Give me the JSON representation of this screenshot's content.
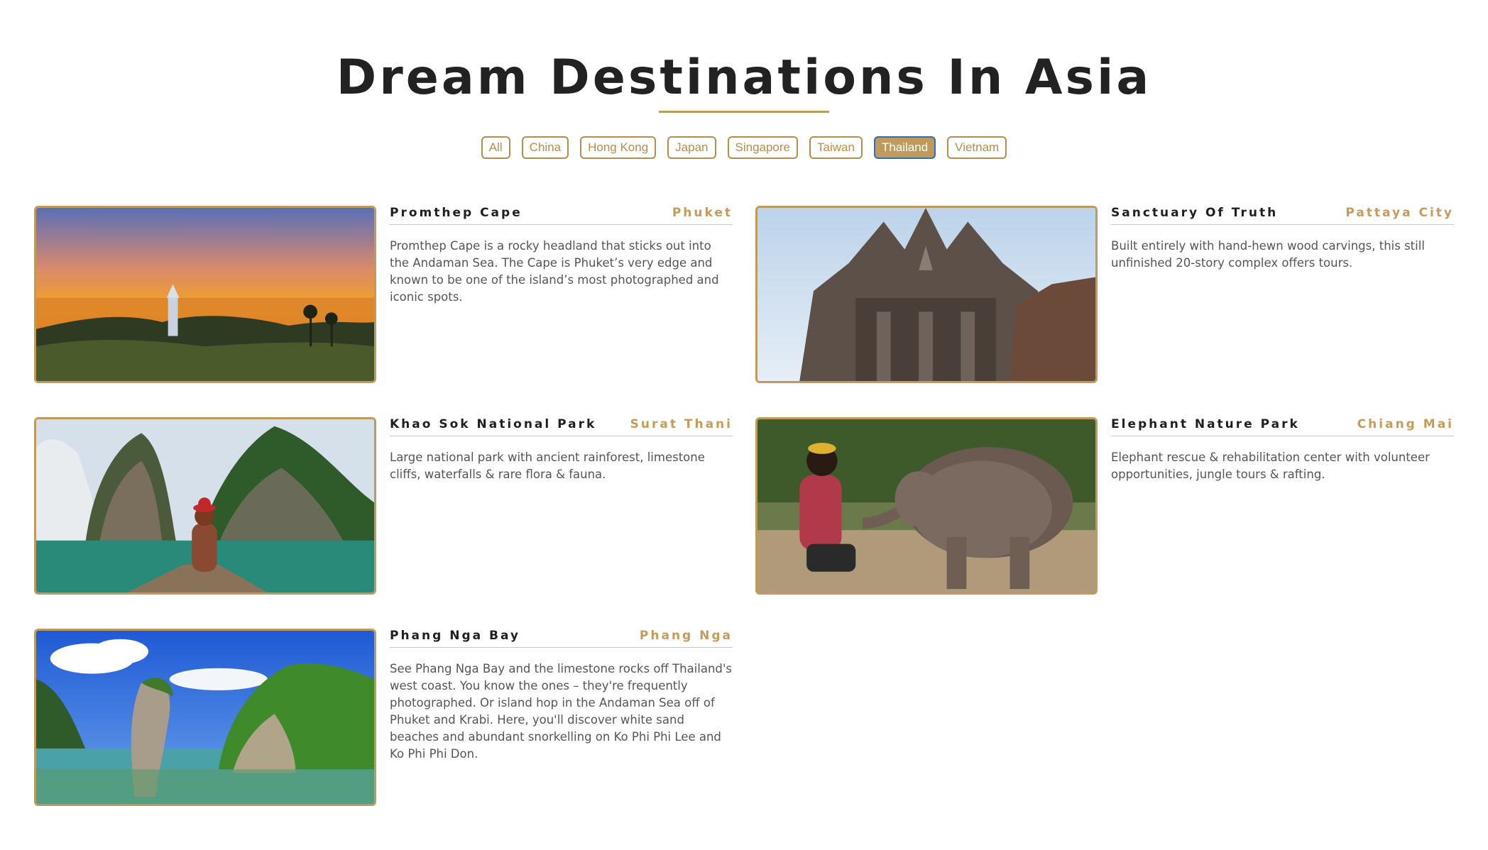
{
  "header": {
    "title": "Dream Destinations In Asia"
  },
  "filters": [
    {
      "label": "All",
      "active": false
    },
    {
      "label": "China",
      "active": false
    },
    {
      "label": "Hong Kong",
      "active": false
    },
    {
      "label": "Japan",
      "active": false
    },
    {
      "label": "Singapore",
      "active": false
    },
    {
      "label": "Taiwan",
      "active": false
    },
    {
      "label": "Thailand",
      "active": true
    },
    {
      "label": "Vietnam",
      "active": false
    }
  ],
  "destinations": [
    {
      "name": "Promthep Cape",
      "location": "Phuket",
      "description": "Promthep Cape is a rocky headland that sticks out into the Andaman Sea. The Cape is Phuket’s very edge and known to be one of the island’s most photographed and iconic spots.",
      "image": "sunset-cape-photo"
    },
    {
      "name": "Sanctuary Of Truth",
      "location": "Pattaya City",
      "description": "Built entirely with hand-hewn wood carvings, this still unfinished 20-story complex offers tours.",
      "image": "wooden-temple-photo"
    },
    {
      "name": "Khao Sok National Park",
      "location": "Surat Thani",
      "description": "Large national park with ancient rainforest, limestone cliffs, waterfalls & rare flora & fauna.",
      "image": "lake-boat-cliffs-photo"
    },
    {
      "name": "Elephant Nature Park",
      "location": "Chiang Mai",
      "description": "Elephant rescue & rehabilitation center with volunteer opportunities, jungle tours & rafting.",
      "image": "baby-elephant-photo"
    },
    {
      "name": "Phang Nga Bay",
      "location": "Phang Nga",
      "description": "See Phang Nga Bay and the limestone rocks off Thailand's west coast. You know the ones – they're frequently photographed. Or island hop in the Andaman Sea off of Phuket and Krabi. Here, you'll discover white sand beaches and abundant snorkelling on Ko Phi Phi Lee and Ko Phi Phi Don.",
      "image": "limestone-islands-bay-photo"
    }
  ],
  "colors": {
    "accent": "#c09a5a",
    "active_border": "#2f6fb8",
    "heading": "#222222"
  }
}
